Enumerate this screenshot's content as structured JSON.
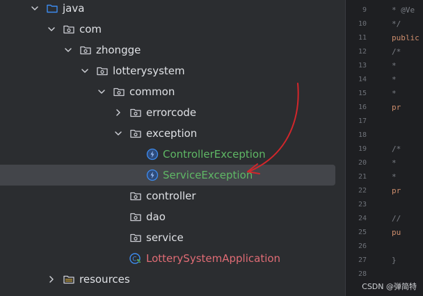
{
  "tree": [
    {
      "label": "java",
      "icon": "source-folder-icon",
      "chevron": "down",
      "indent": 0,
      "color": "normal"
    },
    {
      "label": "com",
      "icon": "package-icon",
      "chevron": "down",
      "indent": 1,
      "color": "normal"
    },
    {
      "label": "zhongge",
      "icon": "package-icon",
      "chevron": "down",
      "indent": 2,
      "color": "normal"
    },
    {
      "label": "lotterysystem",
      "icon": "package-icon",
      "chevron": "down",
      "indent": 3,
      "color": "normal"
    },
    {
      "label": "common",
      "icon": "package-icon",
      "chevron": "down",
      "indent": 4,
      "color": "normal"
    },
    {
      "label": "errorcode",
      "icon": "package-icon",
      "chevron": "right",
      "indent": 5,
      "color": "normal"
    },
    {
      "label": "exception",
      "icon": "package-icon",
      "chevron": "down",
      "indent": 5,
      "color": "normal"
    },
    {
      "label": "ControllerException",
      "icon": "exception-class-icon",
      "chevron": "none",
      "indent": 6,
      "color": "green"
    },
    {
      "label": "ServiceException",
      "icon": "exception-class-icon",
      "chevron": "none",
      "indent": 6,
      "color": "green",
      "selected": true
    },
    {
      "label": "controller",
      "icon": "package-icon",
      "chevron": "none",
      "indent": 5,
      "color": "normal"
    },
    {
      "label": "dao",
      "icon": "package-icon",
      "chevron": "none",
      "indent": 5,
      "color": "normal"
    },
    {
      "label": "service",
      "icon": "package-icon",
      "chevron": "none",
      "indent": 5,
      "color": "normal"
    },
    {
      "label": "LotterySystemApplication",
      "icon": "spring-boot-class-icon",
      "chevron": "none",
      "indent": 5,
      "color": "red"
    },
    {
      "label": "resources",
      "icon": "resources-folder-icon",
      "chevron": "right",
      "indent": 1,
      "color": "normal"
    }
  ],
  "editor": {
    "line_numbers": [
      "9",
      "10",
      "11",
      "12",
      "13",
      "14",
      "15",
      "16",
      "17",
      "18",
      "19",
      "20",
      "21",
      "22",
      "23",
      "24",
      "25",
      "26",
      "27",
      "28"
    ],
    "code": [
      {
        "text": "* @Ve",
        "cls": "c-comment"
      },
      {
        "text": "*/",
        "cls": "c-comment"
      },
      {
        "text": "public",
        "cls": "c-kw"
      },
      {
        "text": "  /*",
        "cls": "c-comment"
      },
      {
        "text": "   *",
        "cls": "c-comment"
      },
      {
        "text": "   *",
        "cls": "c-comment"
      },
      {
        "text": "   *",
        "cls": "c-comment"
      },
      {
        "text": "  pr",
        "cls": "c-kw"
      },
      {
        "text": "",
        "cls": "c-comment"
      },
      {
        "text": "",
        "cls": "c-comment"
      },
      {
        "text": "  /*",
        "cls": "c-comment"
      },
      {
        "text": "   *",
        "cls": "c-comment"
      },
      {
        "text": "   *",
        "cls": "c-comment"
      },
      {
        "text": "  pr",
        "cls": "c-kw"
      },
      {
        "text": "",
        "cls": "c-comment"
      },
      {
        "text": "  //",
        "cls": "c-comment"
      },
      {
        "text": "  pu",
        "cls": "c-kw"
      },
      {
        "text": "",
        "cls": "c-comment"
      },
      {
        "text": "  }",
        "cls": "c-comment"
      },
      {
        "text": "",
        "cls": "c-comment"
      }
    ]
  },
  "watermark": "CSDN @弹简特",
  "colors": {
    "panel_bg": "#2b2d30",
    "editor_bg": "#1e1f22",
    "selection": "#43454a",
    "green_label": "#5fb865",
    "red_label": "#e06c75",
    "arrow": "#d3262b",
    "icon_blue": "#3d8cf0"
  }
}
